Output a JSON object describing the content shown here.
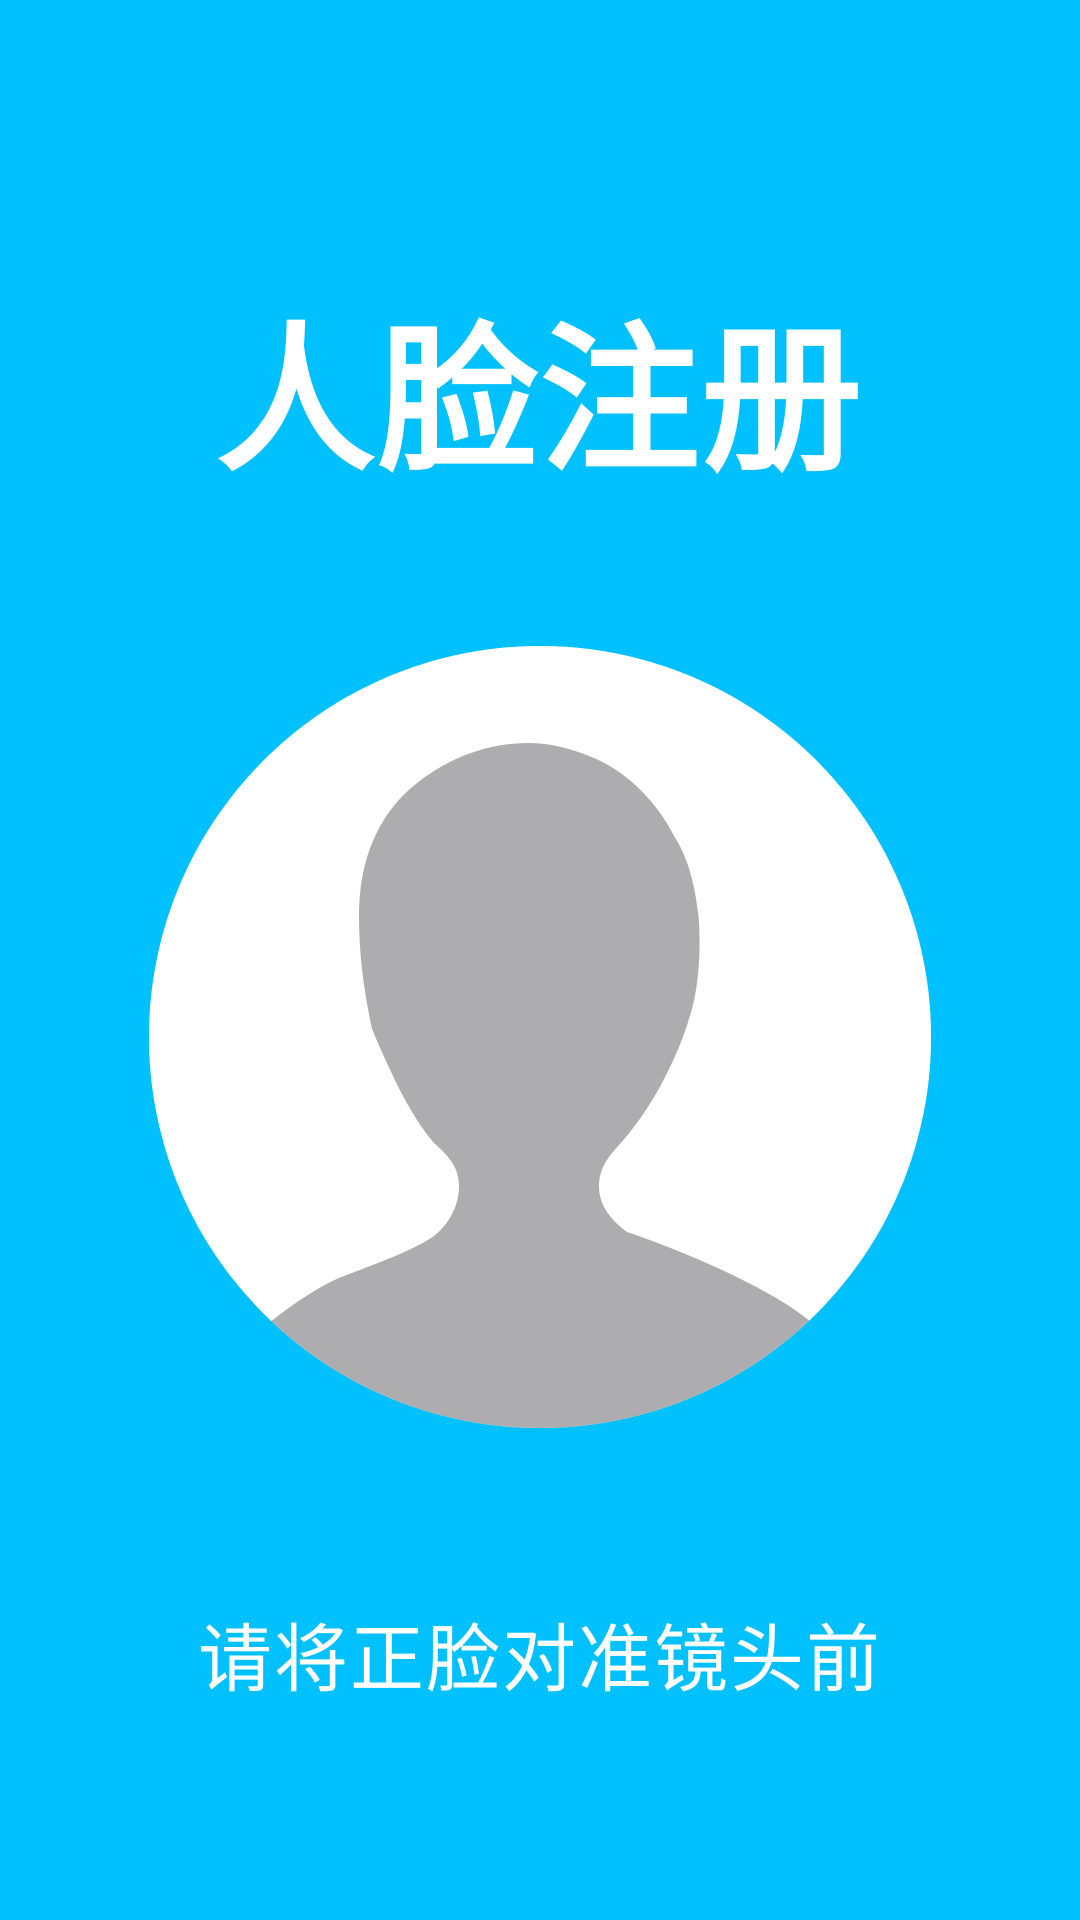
{
  "page": {
    "title": "人脸注册",
    "hint": "请将正脸对准镜头前"
  },
  "colors": {
    "background": "#00c0fd",
    "frame": "#ffffff",
    "silhouette": "#adacaf",
    "text": "#ffffff"
  },
  "icons": {
    "face_placeholder": "person-silhouette-icon"
  }
}
